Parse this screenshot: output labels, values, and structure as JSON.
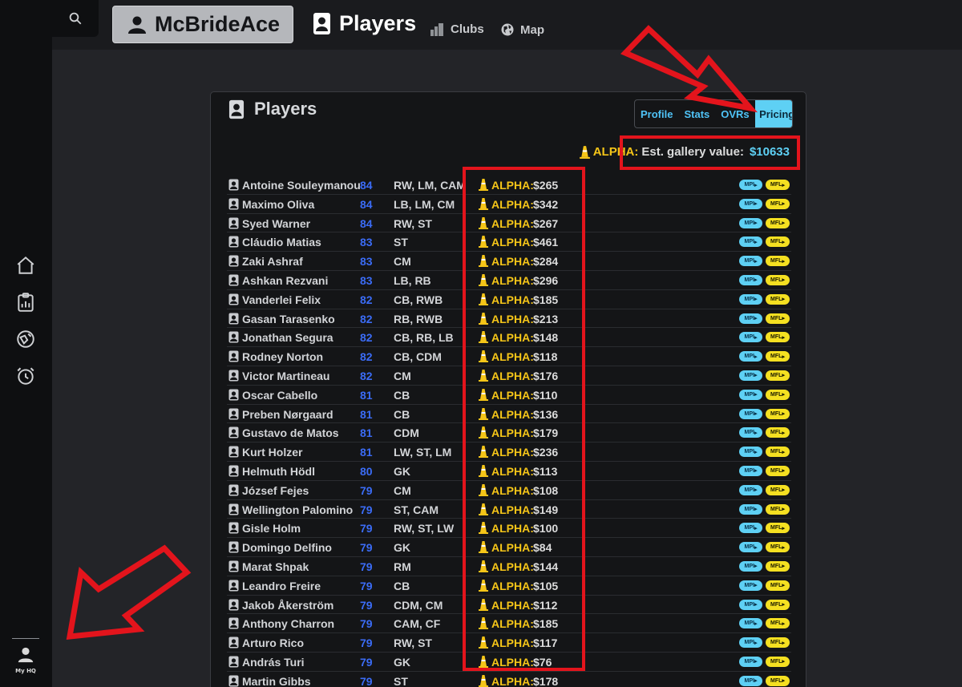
{
  "sidebar": {
    "icons": [
      "home-icon",
      "clipboard-chart-icon",
      "globe-football-icon",
      "alarm-clock-icon"
    ],
    "my_hq_label": "My HQ"
  },
  "topnav": {
    "search_icon": "search-icon",
    "user_label": "McBrideAce",
    "players_label": "Players",
    "clubs_label": "Clubs",
    "map_label": "Map"
  },
  "panel": {
    "title": "Players",
    "tabs": [
      "Profile",
      "Stats",
      "OVRs",
      "Pricing"
    ],
    "active_tab": "Pricing",
    "est_alpha": "ALPHA:",
    "est_label": "Est. gallery value:",
    "est_value": "$10633",
    "alpha_tag": "ALPHA:",
    "mpi_label": "MPI",
    "mfl_label": "MFL"
  },
  "players": [
    {
      "name": "Antoine Souleymanou",
      "ovr": "84",
      "pos": "RW, LM, CAM",
      "price": "$265"
    },
    {
      "name": "Maximo Oliva",
      "ovr": "84",
      "pos": "LB, LM, CM",
      "price": "$342"
    },
    {
      "name": "Syed Warner",
      "ovr": "84",
      "pos": "RW, ST",
      "price": "$267"
    },
    {
      "name": "Cláudio Matias",
      "ovr": "83",
      "pos": "ST",
      "price": "$461"
    },
    {
      "name": "Zaki Ashraf",
      "ovr": "83",
      "pos": "CM",
      "price": "$284"
    },
    {
      "name": "Ashkan Rezvani",
      "ovr": "83",
      "pos": "LB, RB",
      "price": "$296"
    },
    {
      "name": "Vanderlei Felix",
      "ovr": "82",
      "pos": "CB, RWB",
      "price": "$185"
    },
    {
      "name": "Gasan Tarasenko",
      "ovr": "82",
      "pos": "RB, RWB",
      "price": "$213"
    },
    {
      "name": "Jonathan Segura",
      "ovr": "82",
      "pos": "CB, RB, LB",
      "price": "$148"
    },
    {
      "name": "Rodney Norton",
      "ovr": "82",
      "pos": "CB, CDM",
      "price": "$118"
    },
    {
      "name": "Victor Martineau",
      "ovr": "82",
      "pos": "CM",
      "price": "$176"
    },
    {
      "name": "Oscar Cabello",
      "ovr": "81",
      "pos": "CB",
      "price": "$110"
    },
    {
      "name": "Preben Nørgaard",
      "ovr": "81",
      "pos": "CB",
      "price": "$136"
    },
    {
      "name": "Gustavo de Matos",
      "ovr": "81",
      "pos": "CDM",
      "price": "$179"
    },
    {
      "name": "Kurt Holzer",
      "ovr": "81",
      "pos": "LW, ST, LM",
      "price": "$236"
    },
    {
      "name": "Helmuth Hödl",
      "ovr": "80",
      "pos": "GK",
      "price": "$113"
    },
    {
      "name": "József Fejes",
      "ovr": "79",
      "pos": "CM",
      "price": "$108"
    },
    {
      "name": "Wellington Palomino",
      "ovr": "79",
      "pos": "ST, CAM",
      "price": "$149"
    },
    {
      "name": "Gisle Holm",
      "ovr": "79",
      "pos": "RW, ST, LW",
      "price": "$100"
    },
    {
      "name": "Domingo Delfino",
      "ovr": "79",
      "pos": "GK",
      "price": "$84"
    },
    {
      "name": "Marat Shpak",
      "ovr": "79",
      "pos": "RM",
      "price": "$144"
    },
    {
      "name": "Leandro Freire",
      "ovr": "79",
      "pos": "CB",
      "price": "$105"
    },
    {
      "name": "Jakob Åkerström",
      "ovr": "79",
      "pos": "CDM, CM",
      "price": "$112"
    },
    {
      "name": "Anthony Charron",
      "ovr": "79",
      "pos": "CAM, CF",
      "price": "$185"
    },
    {
      "name": "Arturo Rico",
      "ovr": "79",
      "pos": "RW, ST",
      "price": "$117"
    },
    {
      "name": "András Turi",
      "ovr": "79",
      "pos": "GK",
      "price": "$76"
    },
    {
      "name": "Martin Gibbs",
      "ovr": "79",
      "pos": "ST",
      "price": "$178"
    }
  ],
  "colors": {
    "accent_blue": "#5ed0f4",
    "ovr_blue": "#3b6cf6",
    "alpha_yellow": "#f5c518",
    "annotation_red": "#e3141c"
  }
}
